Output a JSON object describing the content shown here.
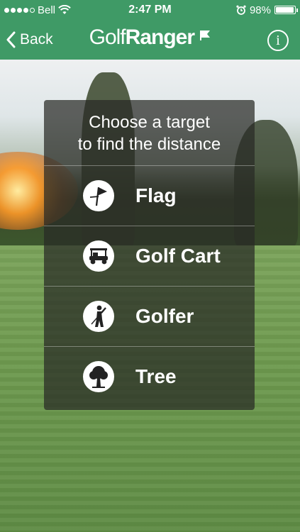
{
  "status": {
    "carrier": "Bell",
    "time": "2:47 PM",
    "battery": "98%",
    "battery_level": 0.98
  },
  "nav": {
    "back_label": "Back",
    "logo_part1": "Golf",
    "logo_part2": "Ranger",
    "info_label": "i"
  },
  "menu": {
    "title_line1": "Choose a target",
    "title_line2": "to find the distance",
    "items": [
      {
        "label": "Flag",
        "icon": "flag-icon"
      },
      {
        "label": "Golf Cart",
        "icon": "golf-cart-icon"
      },
      {
        "label": "Golfer",
        "icon": "golfer-icon"
      },
      {
        "label": "Tree",
        "icon": "tree-icon"
      }
    ]
  },
  "colors": {
    "nav_green": "#3f9a66",
    "panel_bg": "rgba(40,42,38,0.72)"
  }
}
